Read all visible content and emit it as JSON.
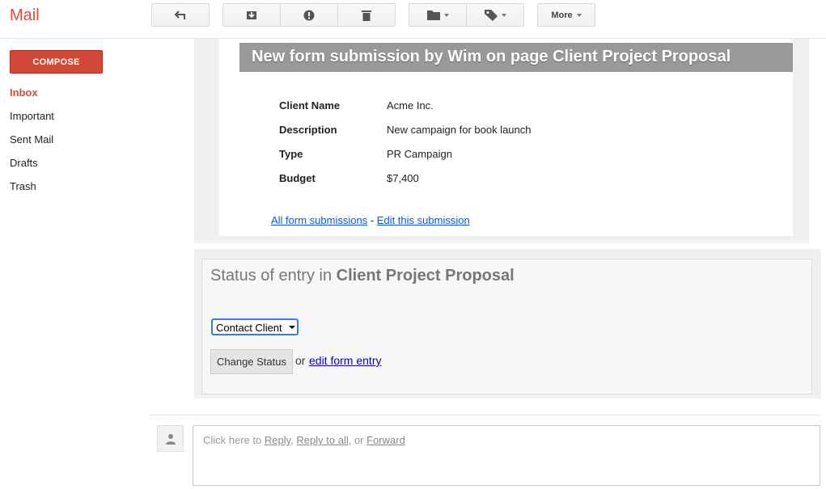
{
  "app": {
    "title": "Mail"
  },
  "toolbar": {
    "more_label": "More"
  },
  "sidebar": {
    "compose_label": "COMPOSE",
    "items": [
      {
        "label": "Inbox",
        "active": true
      },
      {
        "label": "Important"
      },
      {
        "label": "Sent Mail"
      },
      {
        "label": "Drafts"
      },
      {
        "label": "Trash"
      }
    ]
  },
  "message": {
    "banner": "New form submission by Wim on page Client Project Proposal",
    "fields": [
      {
        "label": "Client Name",
        "value": "Acme Inc."
      },
      {
        "label": "Description",
        "value": "New campaign for book launch"
      },
      {
        "label": "Type",
        "value": "PR Campaign"
      },
      {
        "label": "Budget",
        "value": "$7,400"
      }
    ],
    "link_all": "All form submissions",
    "link_separator": "-",
    "link_edit": "Edit this submission"
  },
  "status": {
    "title_prefix": "Status of entry in",
    "title_page": "Client Project Proposal",
    "selected": "Contact Client",
    "button": "Change Status",
    "or_text": "or",
    "edit_link": "edit form entry"
  },
  "reply": {
    "prefix": "Click here to",
    "reply": "Reply",
    "comma": ",",
    "reply_all": "Reply to all",
    "or": ", or",
    "forward": "Forward"
  },
  "colors": {
    "brand": "#dd4b39",
    "compose": "#d14836",
    "link": "#1155cc",
    "banner": "#999999"
  }
}
